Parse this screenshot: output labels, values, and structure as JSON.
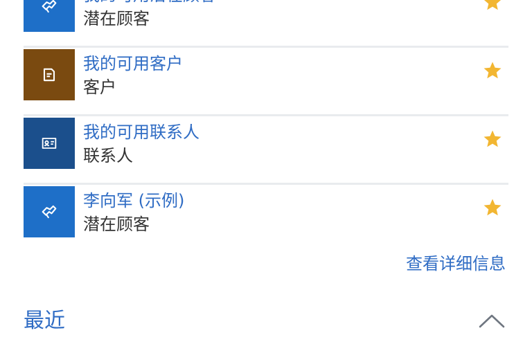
{
  "items": [
    {
      "title": "我的可用潜在顾客",
      "subtitle": "潜在顾客",
      "icon": "lead-icon",
      "tile_color": "#1e6fc8",
      "favorite": true
    },
    {
      "title": "我的可用客户",
      "subtitle": "客户",
      "icon": "account-icon",
      "tile_color": "#7a4a10",
      "favorite": true
    },
    {
      "title": "我的可用联系人",
      "subtitle": "联系人",
      "icon": "contact-icon",
      "tile_color": "#1b4f8c",
      "favorite": true
    },
    {
      "title": "李向军 (示例)",
      "subtitle": "潜在顾客",
      "icon": "lead-icon",
      "tile_color": "#1e6fc8",
      "favorite": true
    }
  ],
  "view_more_label": "查看详细信息",
  "recent": {
    "title": "最近",
    "expanded": true
  },
  "colors": {
    "link": "#2f6cc4",
    "star": "#f2b632",
    "divider": "#e9ebee"
  }
}
